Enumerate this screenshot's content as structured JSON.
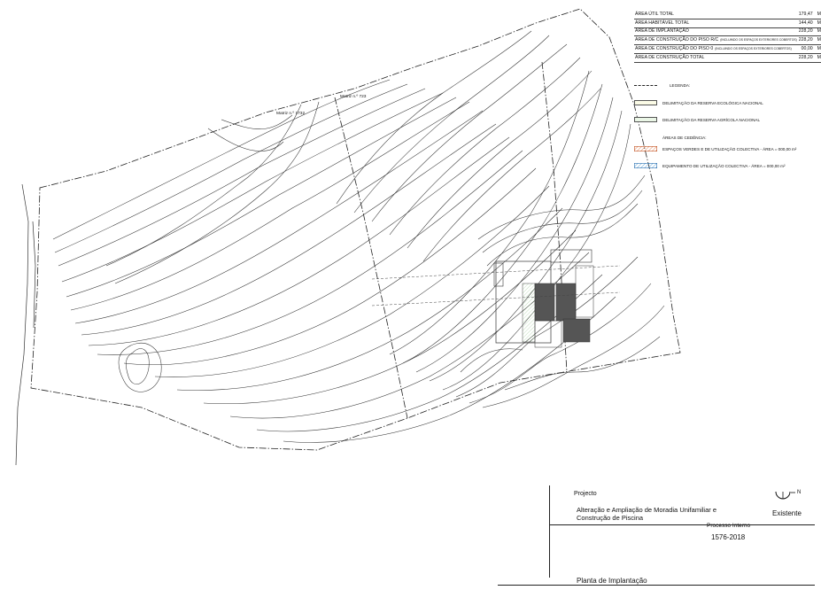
{
  "area_table": [
    {
      "label": "ÁREA ÚTIL TOTAL",
      "note": "",
      "value": "179,47",
      "unit": "M²"
    },
    {
      "label": "ÁREA HABITÁVEL TOTAL",
      "note": "",
      "value": "144,40",
      "unit": "M²"
    },
    {
      "label": "ÁREA DE IMPLANTAÇÃO",
      "note": "",
      "value": "228,20",
      "unit": "M²"
    },
    {
      "label": "ÁREA DE CONSTRUÇÃO DO PISO R/C",
      "note": "(INCLUINDO OS ESPAÇOS EXTERIORES COBERTOS)",
      "value": "228,20",
      "unit": "M²"
    },
    {
      "label": "ÁREA DE CONSTRUÇÃO DO PISO 0",
      "note": "(INCLUINDO OS ESPAÇOS EXTERIORES COBERTOS)",
      "value": "00,00",
      "unit": "M²"
    },
    {
      "label": "ÁREA DE CONSTRUÇÃO TOTAL",
      "note": "",
      "value": "228,20",
      "unit": "M²"
    }
  ],
  "legend": {
    "title": "LEGENDA:",
    "items": [
      {
        "label": "DELIMITAÇÃO DA RESERVA ECOLÓGICA NACIONAL",
        "color": "#f1f1c8"
      },
      {
        "label": "DELIMITAÇÃO DA RESERVA AGRÍCOLA NACIONAL",
        "color": "#d9efd2"
      }
    ],
    "cedencia_title": "ÁREAS DE CEDÊNCIA:",
    "cedencia_items": [
      {
        "label": "ESPAÇOS VERDES E DE UTILIZAÇÃO COLECTIVA - ÁREA = 000,00 m²",
        "color": "#f08a5a"
      },
      {
        "label": "EQUIPAMENTO DE UTILIZAÇÃO COLECTIVA - ÁREA = 000,00 m²",
        "color": "#6fb0e0"
      }
    ]
  },
  "site_labels": {
    "matriz_1": "Matriz n.º 1732",
    "matriz_2": "Matriz n.º 723"
  },
  "title_block": {
    "projecto_label": "Projecto",
    "project_title_line1": "Alteração e Ampliação de Moradia Unifamiliar e",
    "project_title_line2": "Construção de Piscina",
    "status": "Existente",
    "north_letter": "N",
    "processo_label": "Processo Interno",
    "processo_number": "1576-2018",
    "drawing_title": "Planta de Implantação"
  }
}
